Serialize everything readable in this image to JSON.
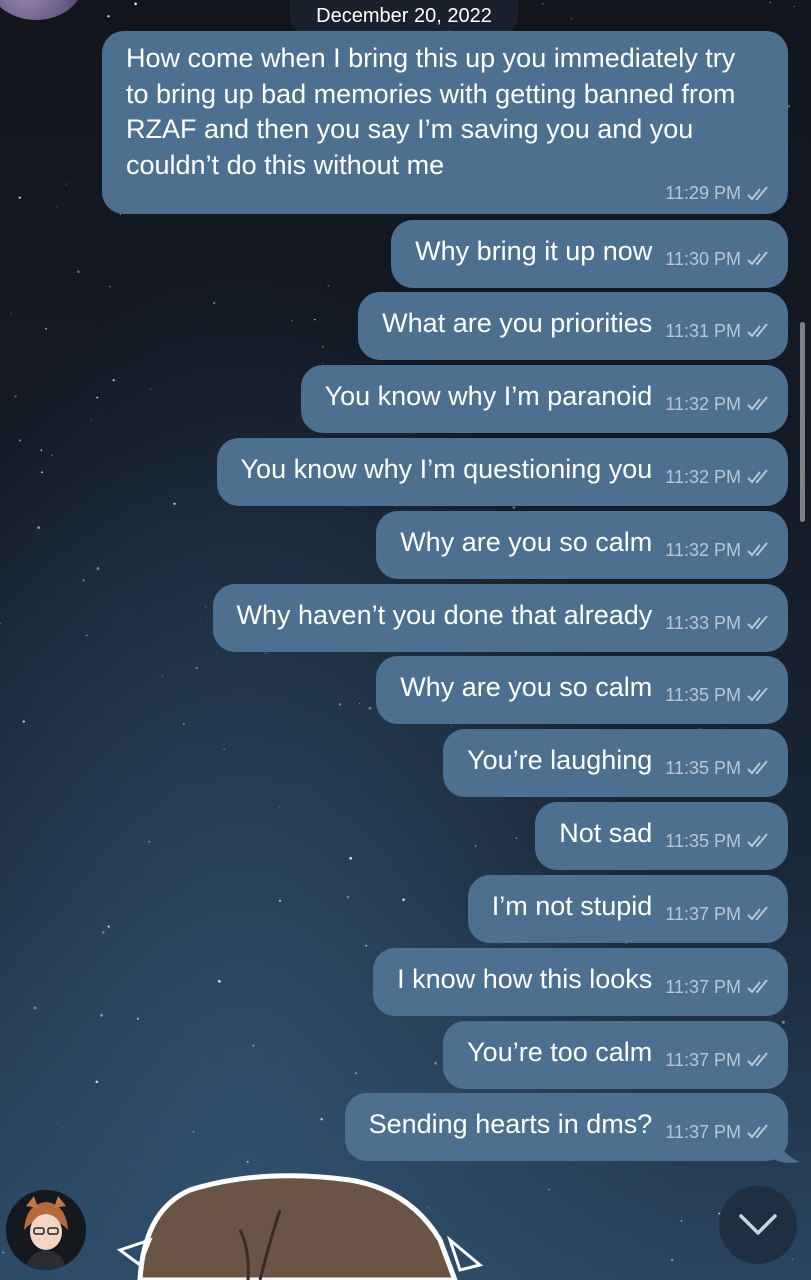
{
  "date_header": "December 20, 2022",
  "messages": [
    {
      "text": "How come when I bring this up you immediately try to bring up bad memories with getting banned from RZAF and then you say I’m saving you and you couldn’t do this without me",
      "time": "11:29 PM"
    },
    {
      "text": "Why bring it up now",
      "time": "11:30 PM"
    },
    {
      "text": "What are you priorities",
      "time": "11:31 PM"
    },
    {
      "text": "You know why I’m paranoid",
      "time": "11:32 PM"
    },
    {
      "text": "You know why I’m questioning you",
      "time": "11:32 PM"
    },
    {
      "text": "Why are you so calm",
      "time": "11:32 PM"
    },
    {
      "text": "Why haven’t you done that already",
      "time": "11:33 PM"
    },
    {
      "text": "Why are you so calm",
      "time": "11:35 PM"
    },
    {
      "text": "You’re laughing",
      "time": "11:35 PM"
    },
    {
      "text": "Not sad",
      "time": "11:35 PM"
    },
    {
      "text": "I’m not stupid",
      "time": "11:37 PM"
    },
    {
      "text": "I know how this looks",
      "time": "11:37 PM"
    },
    {
      "text": "You’re too calm",
      "time": "11:37 PM"
    },
    {
      "text": "Sending hearts in dms?",
      "time": "11:37 PM"
    }
  ],
  "icons": {
    "read_receipt": "double-check-icon",
    "scroll_down": "chevron-down-icon"
  },
  "colors": {
    "bubble_outgoing": "#4e7090",
    "timestamp": "#b7c7d6"
  }
}
